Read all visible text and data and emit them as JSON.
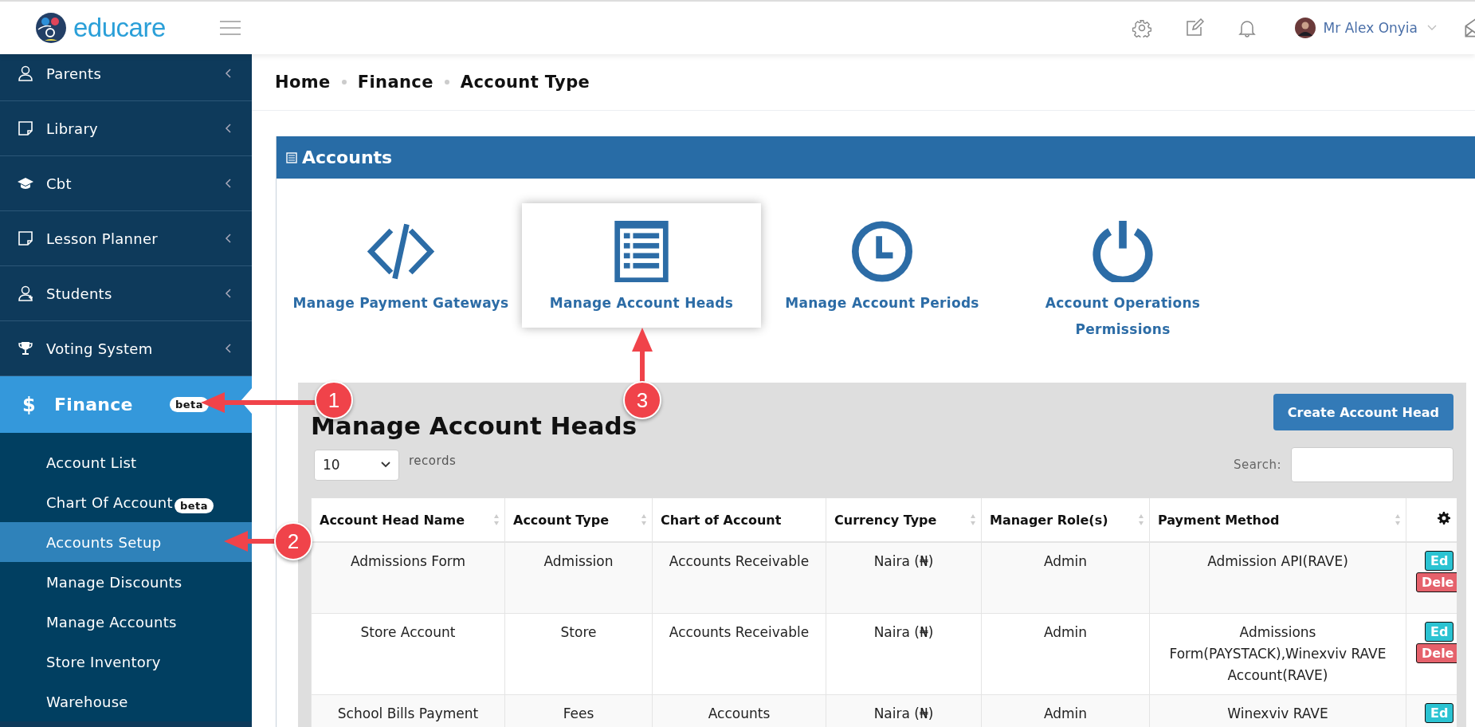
{
  "topbar": {
    "logo_text": "educare",
    "user_name": "Mr Alex Onyia"
  },
  "sidebar": {
    "items": [
      {
        "label": "Parents",
        "selected": false,
        "expanded": false
      },
      {
        "label": "Library",
        "selected": false,
        "expanded": false
      },
      {
        "label": "Cbt",
        "selected": false,
        "expanded": false
      },
      {
        "label": "Lesson Planner",
        "selected": false,
        "expanded": false
      },
      {
        "label": "Students",
        "selected": false,
        "expanded": false
      },
      {
        "label": "Voting System",
        "selected": false,
        "expanded": false
      },
      {
        "label": "Finance",
        "icon_text": "$",
        "badge": "beta",
        "selected": true,
        "expanded": true,
        "children": [
          {
            "label": "Account List",
            "selected": false
          },
          {
            "label": "Chart Of Account",
            "badge": "beta",
            "selected": false
          },
          {
            "label": "Accounts Setup",
            "selected": true
          },
          {
            "label": "Manage Discounts",
            "selected": false
          },
          {
            "label": "Manage Accounts",
            "selected": false
          },
          {
            "label": "Store Inventory",
            "selected": false
          },
          {
            "label": "Warehouse",
            "selected": false
          }
        ]
      }
    ]
  },
  "breadcrumb": [
    "Home",
    "Finance",
    "Account Type"
  ],
  "panel": {
    "title": "Accounts",
    "tiles": [
      {
        "label": "Manage Payment Gateways",
        "selected": false
      },
      {
        "label": "Manage Account Heads",
        "selected": true
      },
      {
        "label": "Manage Account Periods",
        "selected": false
      },
      {
        "label": "Account Operations Permissions",
        "selected": false
      }
    ]
  },
  "manage": {
    "title": "Manage Account Heads",
    "create_button": "Create Account Head",
    "page_size": "10",
    "records_label": "records",
    "search_label": "Search:",
    "columns": [
      {
        "label": "Account Head Name",
        "sortable": true
      },
      {
        "label": "Account Type",
        "sortable": true
      },
      {
        "label": "Chart of Account",
        "sortable": false
      },
      {
        "label": "Currency Type",
        "sortable": true
      },
      {
        "label": "Manager Role(s)",
        "sortable": true
      },
      {
        "label": "Payment Method",
        "sortable": true
      }
    ],
    "rows": [
      {
        "cells": [
          "Admissions Form",
          "Admission",
          "Accounts Receivable",
          "Naira (₦)",
          "Admin",
          "Admission API(RAVE)"
        ],
        "actions": [
          {
            "label": "Ed",
            "kind": "edit"
          },
          {
            "label": "Dele",
            "kind": "delete"
          }
        ]
      },
      {
        "cells": [
          "Store Account",
          "Store",
          "Accounts Receivable",
          "Naira (₦)",
          "Admin",
          "Admissions Form(PAYSTACK),Winexviv RAVE Account(RAVE)"
        ],
        "actions": [
          {
            "label": "Ed",
            "kind": "edit"
          },
          {
            "label": "Dele",
            "kind": "delete"
          }
        ]
      },
      {
        "cells": [
          "School Bills Payment",
          "Fees",
          "Accounts",
          "Naira (₦)",
          "Admin",
          "Winexviv RAVE"
        ],
        "actions": [
          {
            "label": "Ed",
            "kind": "edit"
          }
        ]
      }
    ]
  },
  "annotations": [
    {
      "number": "1"
    },
    {
      "number": "2"
    },
    {
      "number": "3"
    }
  ]
}
